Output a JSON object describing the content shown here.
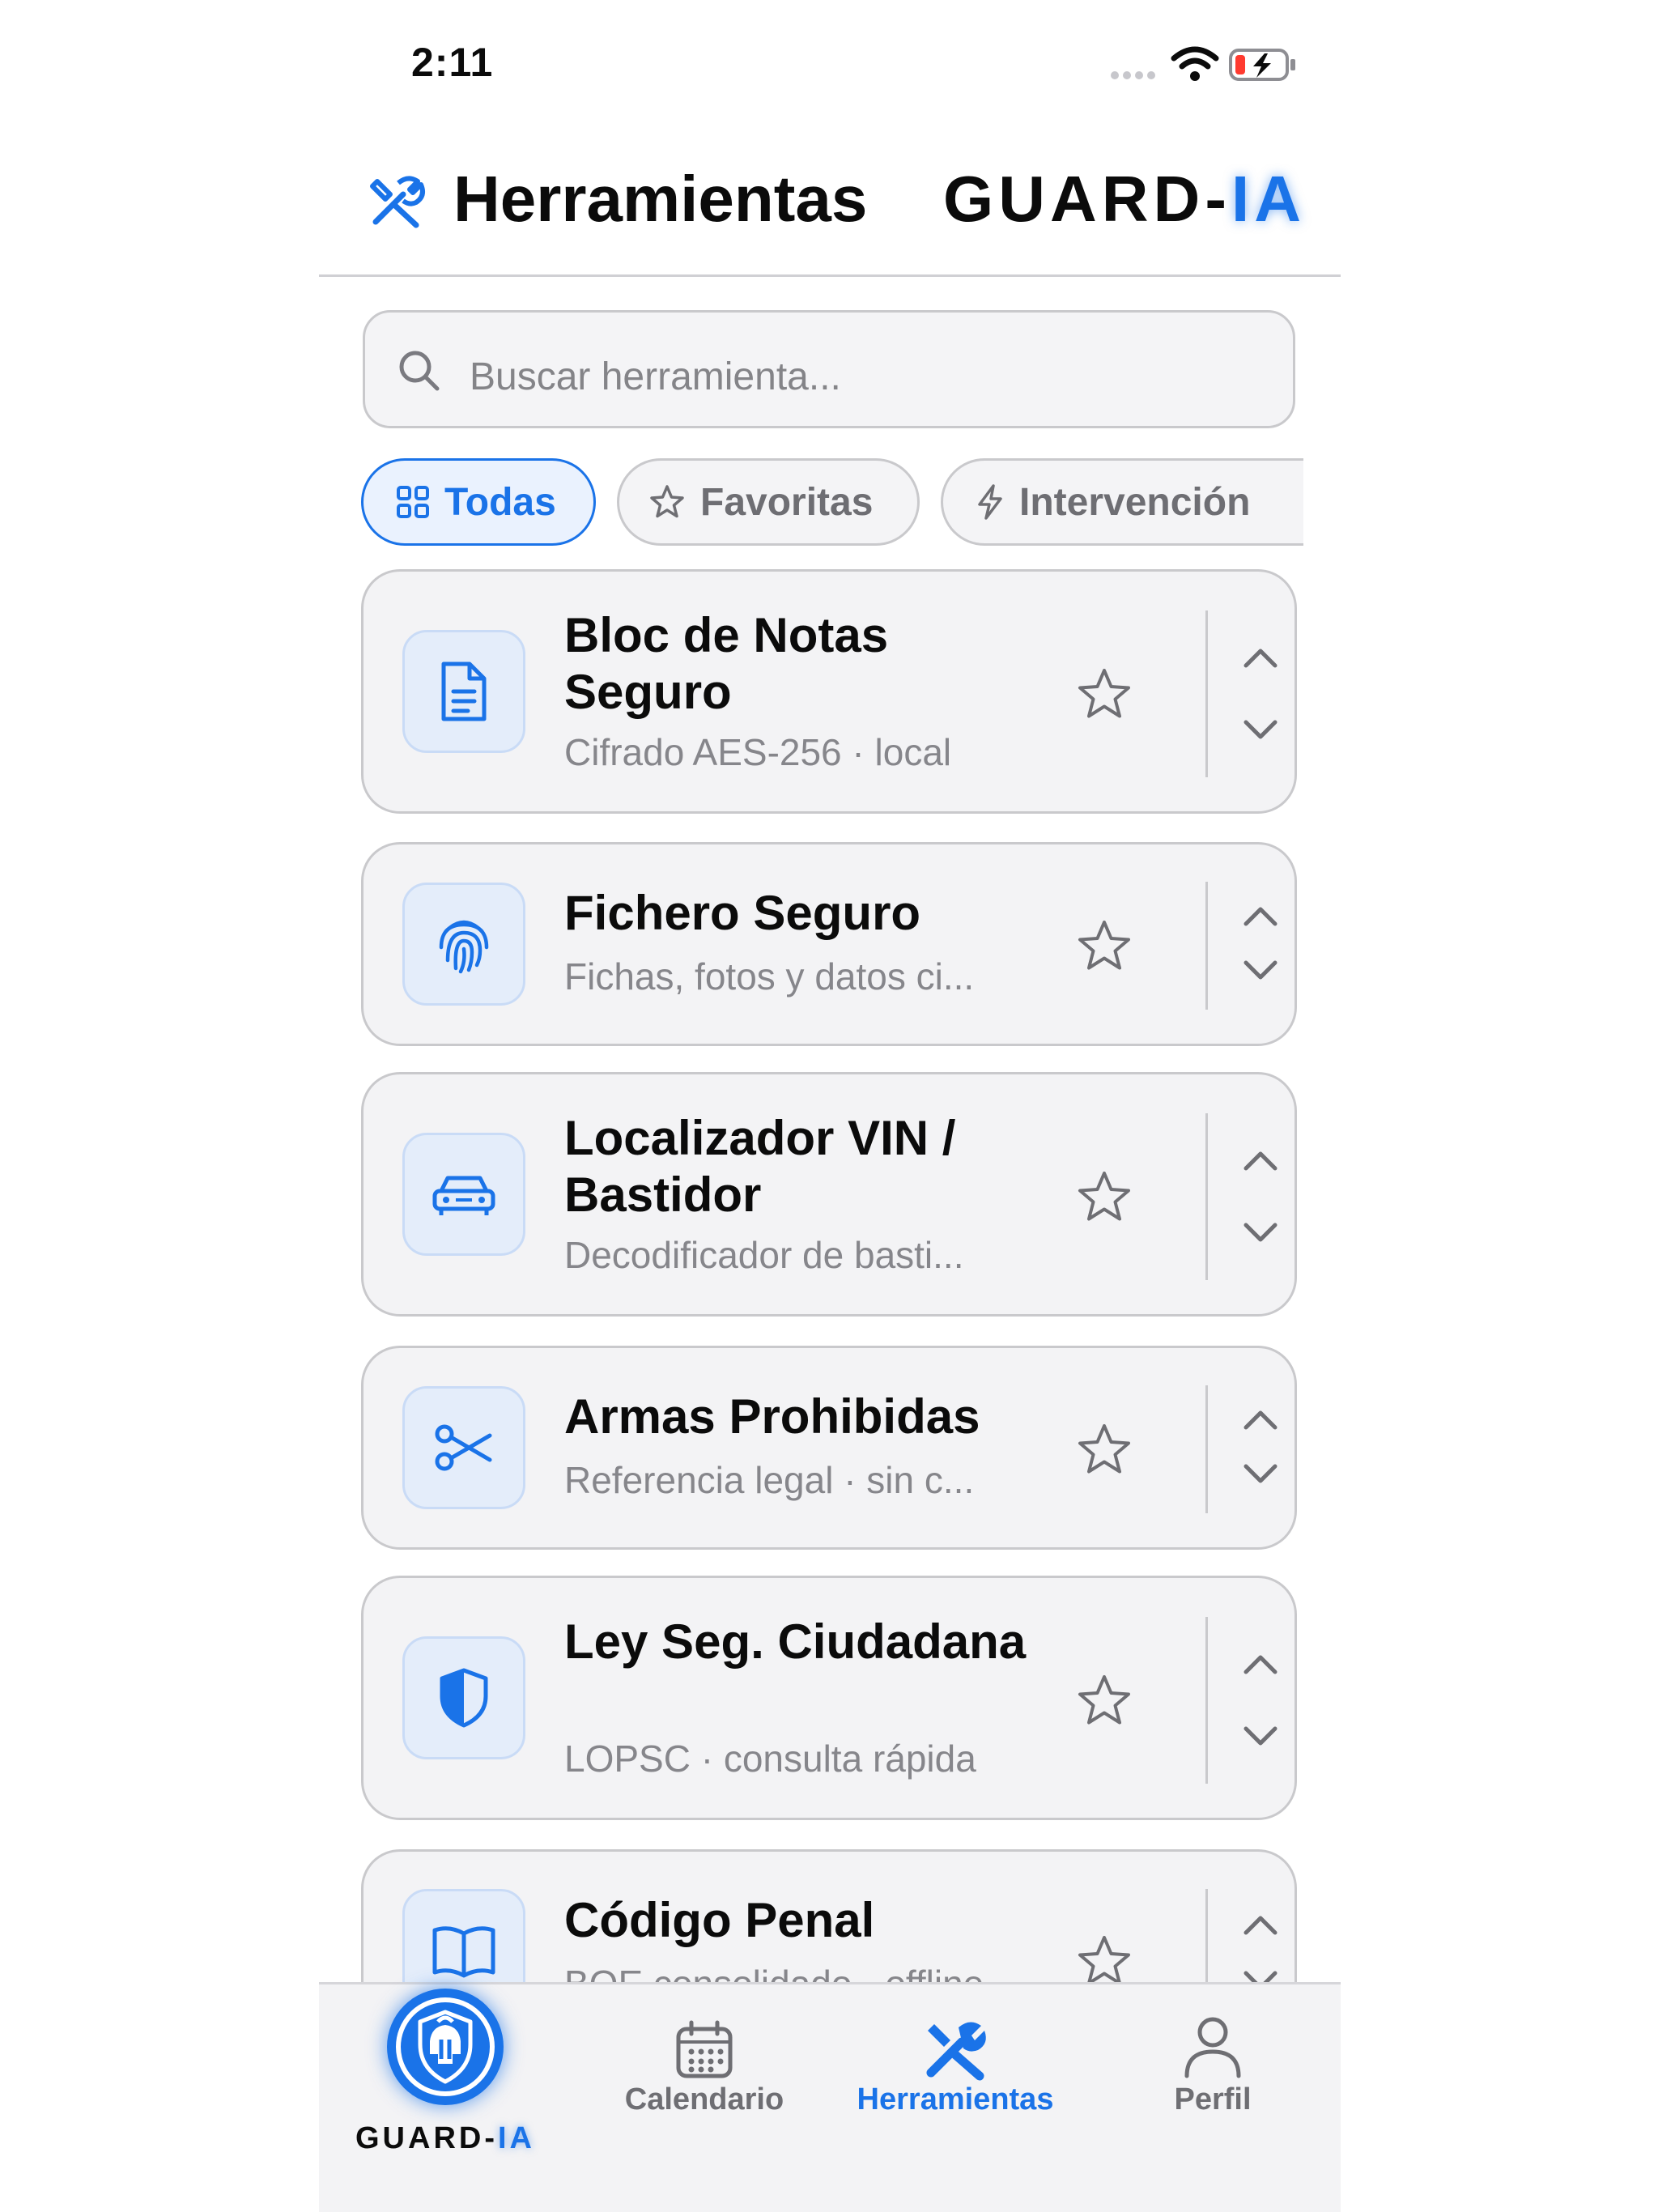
{
  "status_bar": {
    "time": "2:11"
  },
  "header": {
    "title": "Herramientas",
    "brand_prefix": "GUARD-",
    "brand_accent": "IA",
    "icon": "tools-icon"
  },
  "search": {
    "placeholder": "Buscar herramienta..."
  },
  "filters": [
    {
      "label": "Todas",
      "icon": "grid-icon",
      "active": true
    },
    {
      "label": "Favoritas",
      "icon": "star-icon",
      "active": false
    },
    {
      "label": "Intervención",
      "icon": "bolt-icon",
      "active": false
    }
  ],
  "tools": [
    {
      "title": "Bloc de Notas Seguro",
      "subtitle": "Cifrado AES-256 · local",
      "icon": "document-icon"
    },
    {
      "title": "Fichero Seguro",
      "subtitle": "Fichas, fotos y datos ci...",
      "icon": "fingerprint-icon"
    },
    {
      "title": "Localizador VIN / Bastidor",
      "subtitle": "Decodificador de basti...",
      "icon": "car-icon"
    },
    {
      "title": "Armas Prohibidas",
      "subtitle": "Referencia legal · sin c...",
      "icon": "scissors-icon"
    },
    {
      "title": "Ley Seg. Ciudadana",
      "subtitle": "LOPSC · consulta rápida",
      "icon": "shield-icon"
    },
    {
      "title": "Código Penal",
      "subtitle": "BOE consolidado · offline",
      "icon": "book-icon"
    }
  ],
  "tabbar": {
    "home_prefix": "GUARD-",
    "home_accent": "IA",
    "calendar": "Calendario",
    "tools": "Herramientas",
    "profile": "Perfil"
  },
  "colors": {
    "accent": "#1a73e8",
    "text": "#0b0b0b",
    "muted": "#86868b",
    "card_bg": "#f3f3f5"
  }
}
